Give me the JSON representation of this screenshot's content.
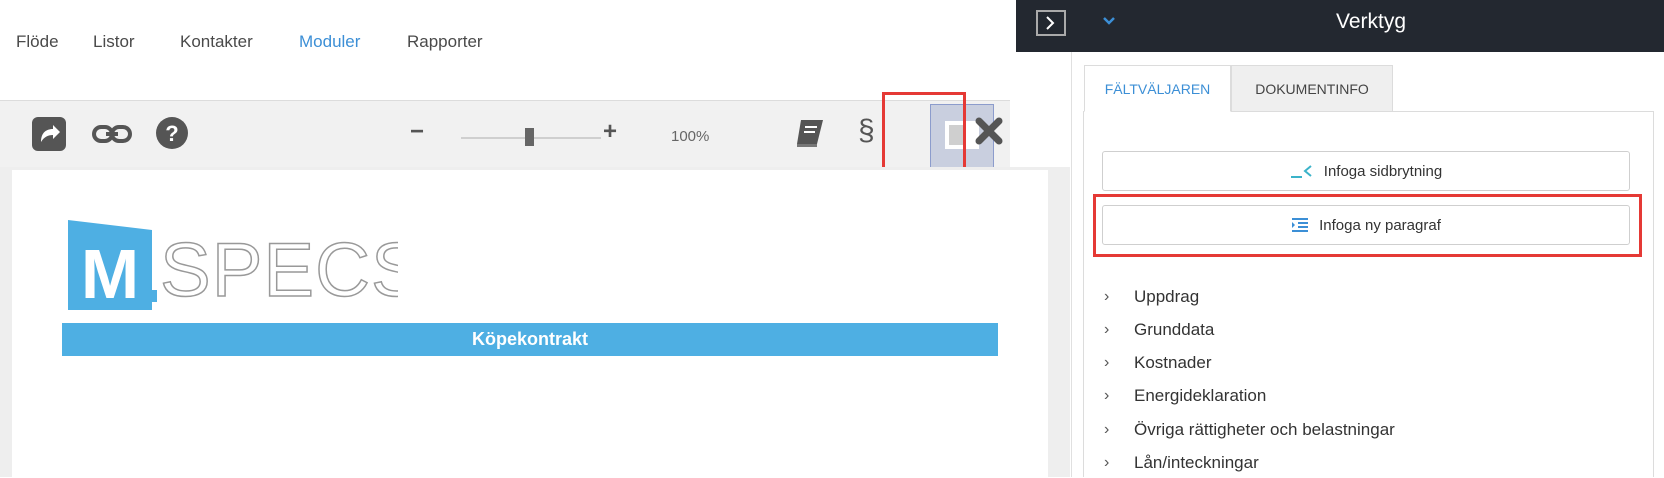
{
  "nav": {
    "items": [
      "Flöde",
      "Listor",
      "Kontakter",
      "Moduler",
      "Rapporter"
    ],
    "active_index": 3
  },
  "toolbar": {
    "zoom_minus": "−",
    "zoom_plus": "+",
    "zoom_label": "100%",
    "section_symbol": "§"
  },
  "document": {
    "logo_letter": "M",
    "logo_text": "SPECS",
    "banner_text": "Köpekontrakt"
  },
  "panel": {
    "title": "Verktyg",
    "tabs": [
      "FÄLTVÄLJAREN",
      "DOKUMENTINFO"
    ],
    "buttons": {
      "page_break": "Infoga sidbrytning",
      "new_paragraph": "Infoga ny paragraf"
    },
    "tree": [
      "Uppdrag",
      "Grunddata",
      "Kostnader",
      "Energideklaration",
      "Övriga rättigheter och belastningar",
      "Lån/inteckningar"
    ]
  },
  "colors": {
    "accent": "#3c8fd6",
    "banner": "#4eafe3",
    "highlight": "#e53935",
    "panel_header": "#232830"
  }
}
